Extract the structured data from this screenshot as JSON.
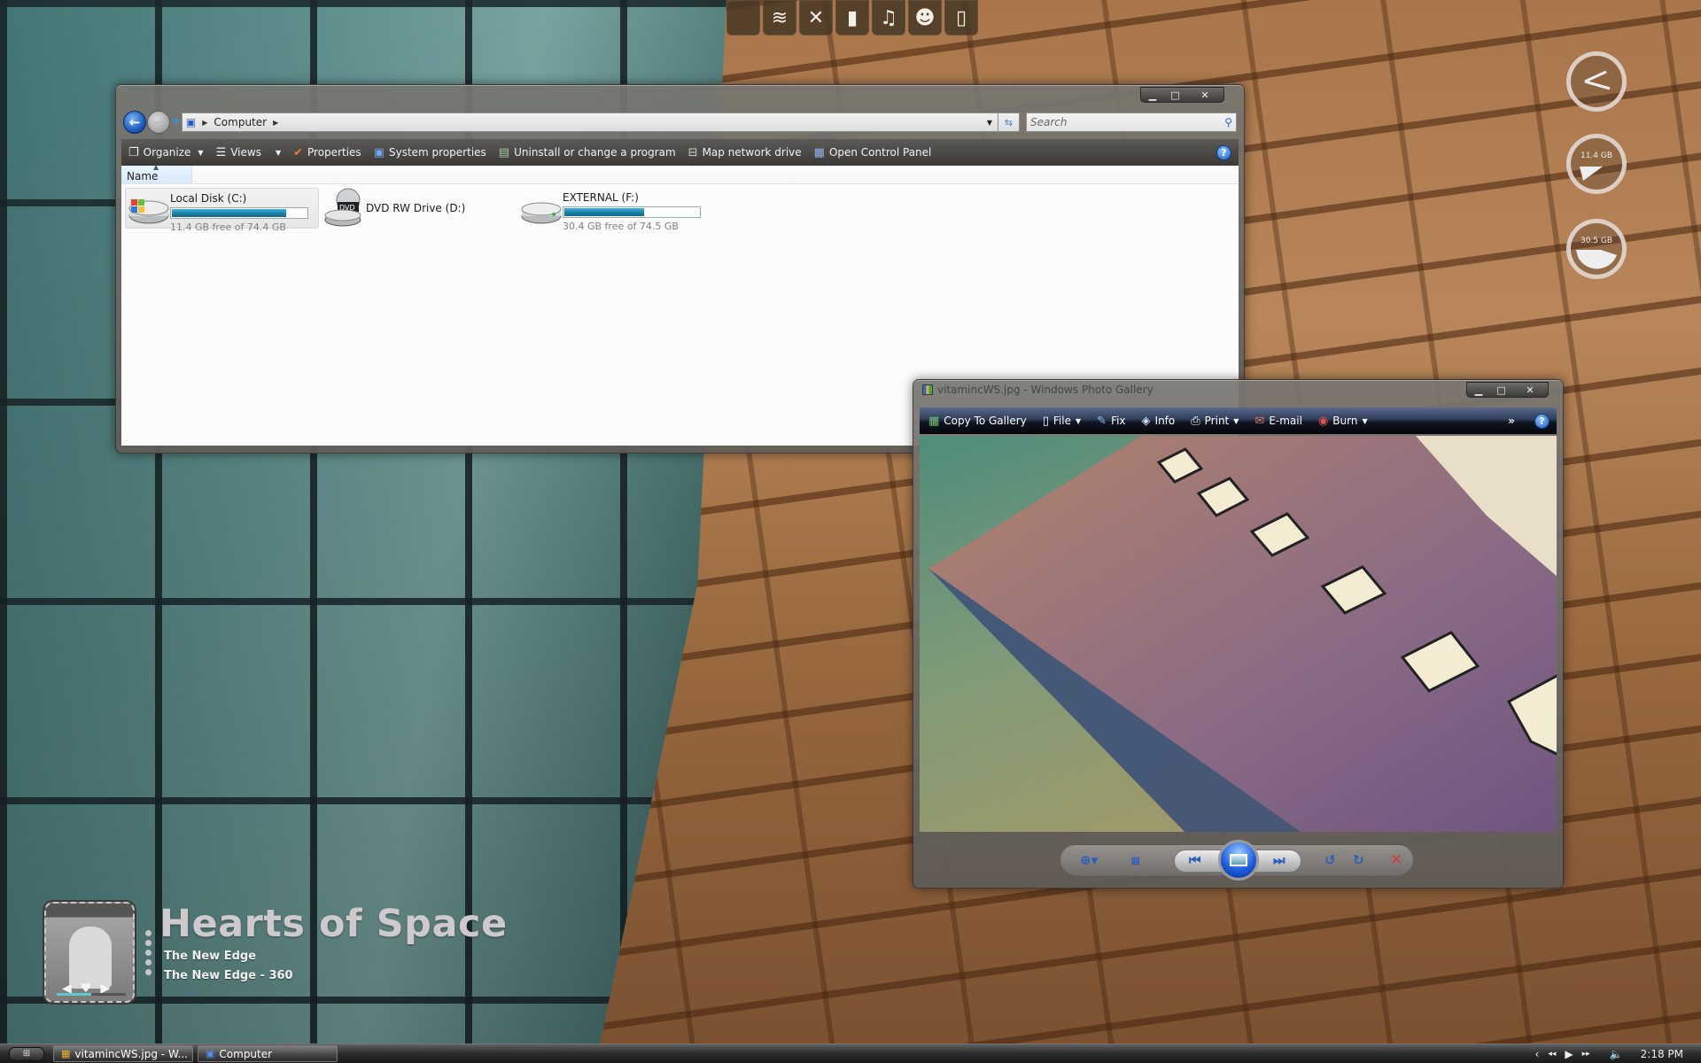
{
  "dock": {
    "items": [
      {
        "name": "apple",
        "glyph": ""
      },
      {
        "name": "wifi",
        "glyph": "≋"
      },
      {
        "name": "tools",
        "glyph": "✕"
      },
      {
        "name": "trash",
        "glyph": "▮"
      },
      {
        "name": "music",
        "glyph": "♫"
      },
      {
        "name": "people",
        "glyph": "☻"
      },
      {
        "name": "calendar",
        "glyph": "▯"
      }
    ]
  },
  "gadgets": {
    "disk_c": {
      "label": "11.4 GB",
      "fill_fraction": 0.15
    },
    "disk_f": {
      "label": "30.5 GB",
      "fill_fraction": 0.41
    }
  },
  "explorer": {
    "breadcrumb": [
      "Computer"
    ],
    "search_placeholder": "Search",
    "commands": [
      {
        "label": "Organize",
        "icon": "organize",
        "dropdown": true
      },
      {
        "label": "Views",
        "icon": "views",
        "dropdown": true
      },
      {
        "label": "Properties",
        "icon": "checkmark"
      },
      {
        "label": "System properties",
        "icon": "monitor"
      },
      {
        "label": "Uninstall or change a program",
        "icon": "programs"
      },
      {
        "label": "Map network drive",
        "icon": "network-drive"
      },
      {
        "label": "Open Control Panel",
        "icon": "control-panel"
      }
    ],
    "column_header": "Name",
    "drives": [
      {
        "name": "Local Disk (C:)",
        "free_text": "11.4 GB free of 74.4 GB",
        "used_fraction": 0.847,
        "icon": "windows-drive",
        "selected": true
      },
      {
        "name": "DVD RW Drive (D:)",
        "icon": "dvd-drive",
        "badge": "DVD"
      },
      {
        "name": "EXTERNAL (F:)",
        "free_text": "30.4 GB free of 74.5 GB",
        "used_fraction": 0.592,
        "icon": "hard-drive"
      }
    ]
  },
  "gallery": {
    "title": "vitamincWS.jpg - Windows Photo Gallery",
    "toolbar": [
      {
        "label": "Copy To Gallery",
        "icon": "copy-to-gallery"
      },
      {
        "label": "File",
        "icon": "file",
        "dropdown": true
      },
      {
        "label": "Fix",
        "icon": "fix"
      },
      {
        "label": "Info",
        "icon": "info-tag"
      },
      {
        "label": "Print",
        "icon": "printer",
        "dropdown": true
      },
      {
        "label": "E-mail",
        "icon": "email"
      },
      {
        "label": "Burn",
        "icon": "disc",
        "dropdown": true
      }
    ],
    "more": "»",
    "help": "?"
  },
  "music": {
    "title": "Hearts of Space",
    "line1": "The New Edge",
    "line2": "The New Edge - 360",
    "progress_fraction": 0.5
  },
  "taskbar": {
    "start": "⊞",
    "buttons": [
      {
        "label": "vitamincWS.jpg - W...",
        "icon": "photo-gallery"
      },
      {
        "label": "Computer",
        "icon": "computer"
      }
    ],
    "media": {
      "prev": "‹",
      "rew": "◂◂",
      "play": "▶",
      "ff": "▸▸"
    },
    "volume": "🔈",
    "clock": "2:18 PM"
  },
  "window_controls": {
    "minimize": "▁",
    "maximize": "□",
    "close": "✕"
  }
}
